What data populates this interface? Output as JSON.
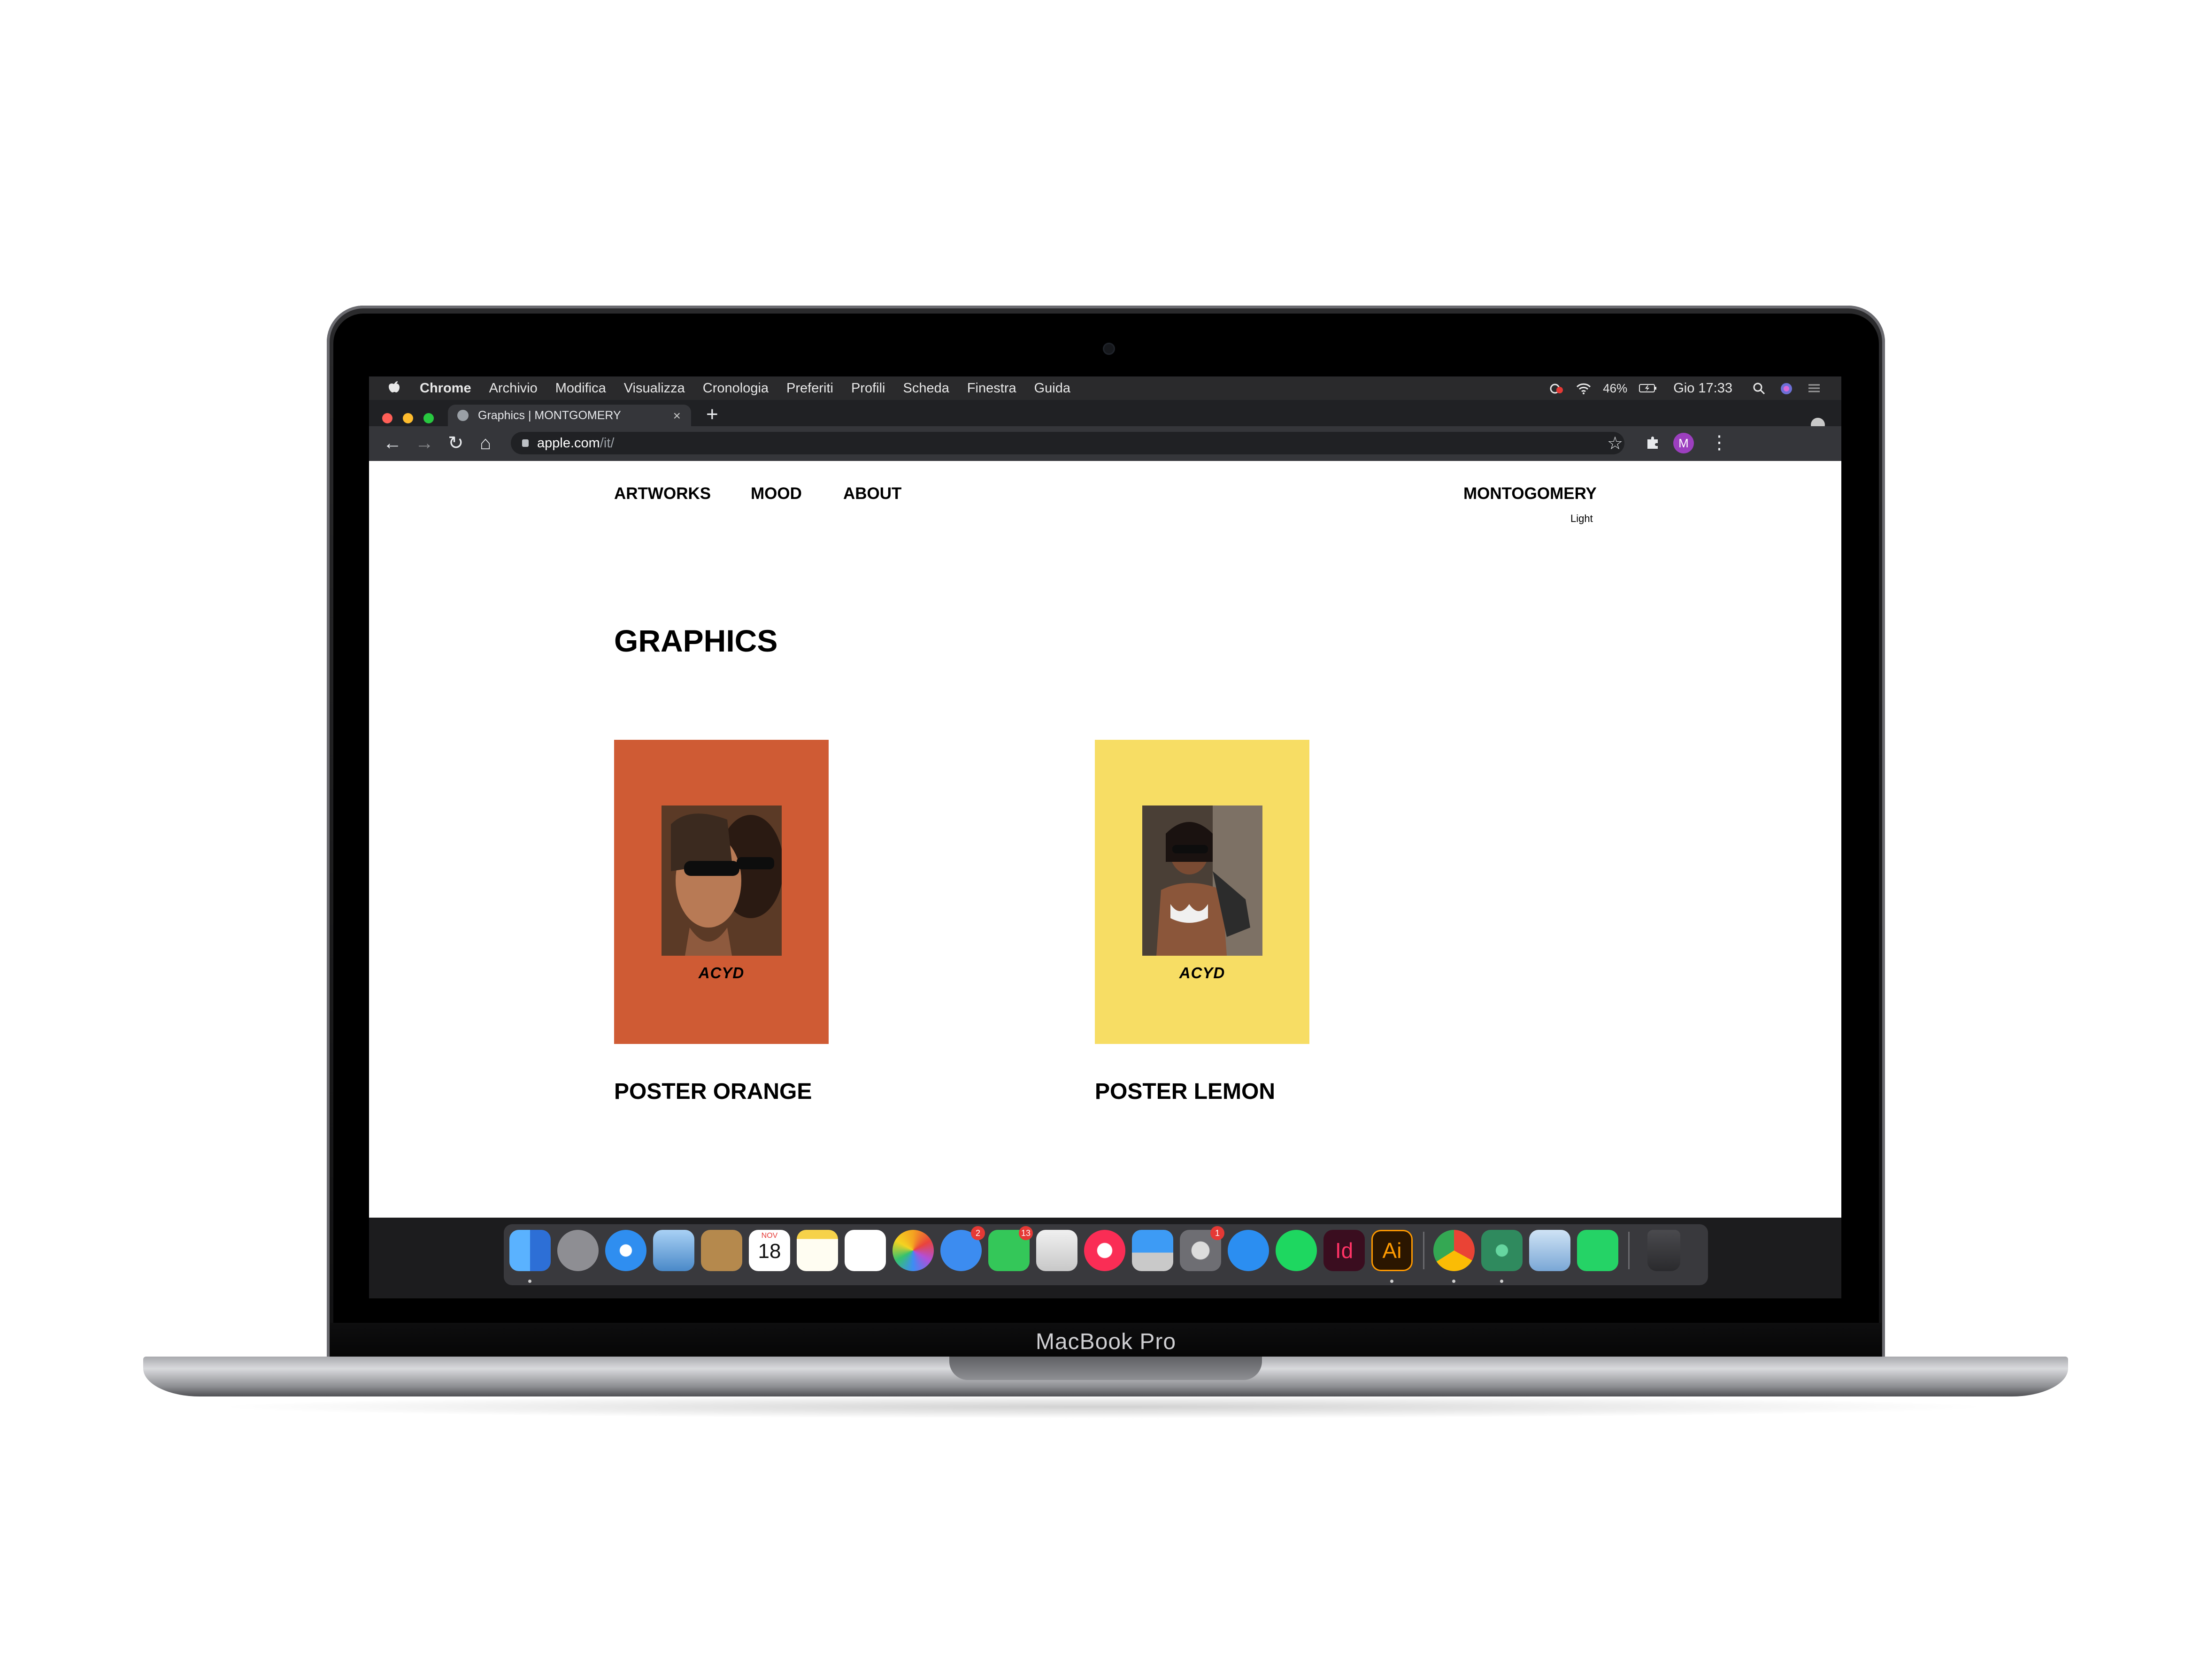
{
  "device": {
    "label": "MacBook Pro"
  },
  "menubar": {
    "app_name": "Chrome",
    "items": [
      "Archivio",
      "Modifica",
      "Visualizza",
      "Cronologia",
      "Preferiti",
      "Profili",
      "Scheda",
      "Finestra",
      "Guida"
    ],
    "battery": "46%",
    "clock": "Gio 17:33"
  },
  "browser": {
    "tab_title": "Graphics | MONTGOMERY",
    "url_host": "apple.com",
    "url_path": "/it/",
    "profile_initial": "M"
  },
  "site": {
    "nav": [
      "ARTWORKS",
      "MOOD",
      "ABOUT"
    ],
    "brand": "MONTOGOMERY",
    "mode_toggle": "Light",
    "heading": "GRAPHICS",
    "posters": [
      {
        "label": "POSTER ORANGE",
        "brand": "ACYD",
        "background": "#cf5b34"
      },
      {
        "label": "POSTER LEMON",
        "brand": "ACYD",
        "background": "#f7dd64"
      }
    ]
  },
  "dock": {
    "apps": [
      "Finder",
      "Launchpad",
      "Safari",
      "Mail",
      "Contacts",
      "Calendar",
      "Notes",
      "Reminders",
      "Photos",
      "Messages",
      "FaceTime",
      "Preview",
      "Music",
      "Keynote",
      "System Preferences",
      "App Store",
      "Spotify",
      "InDesign",
      "Illustrator",
      "Google Chrome",
      "Atom",
      "Image Capture",
      "WhatsApp",
      "Trash"
    ],
    "calendar_month": "NOV",
    "calendar_day": "18",
    "indesign_label": "Id",
    "illustrator_label": "Ai",
    "badges": {
      "messages": "2",
      "facetime": "13",
      "system_preferences": "1"
    }
  }
}
